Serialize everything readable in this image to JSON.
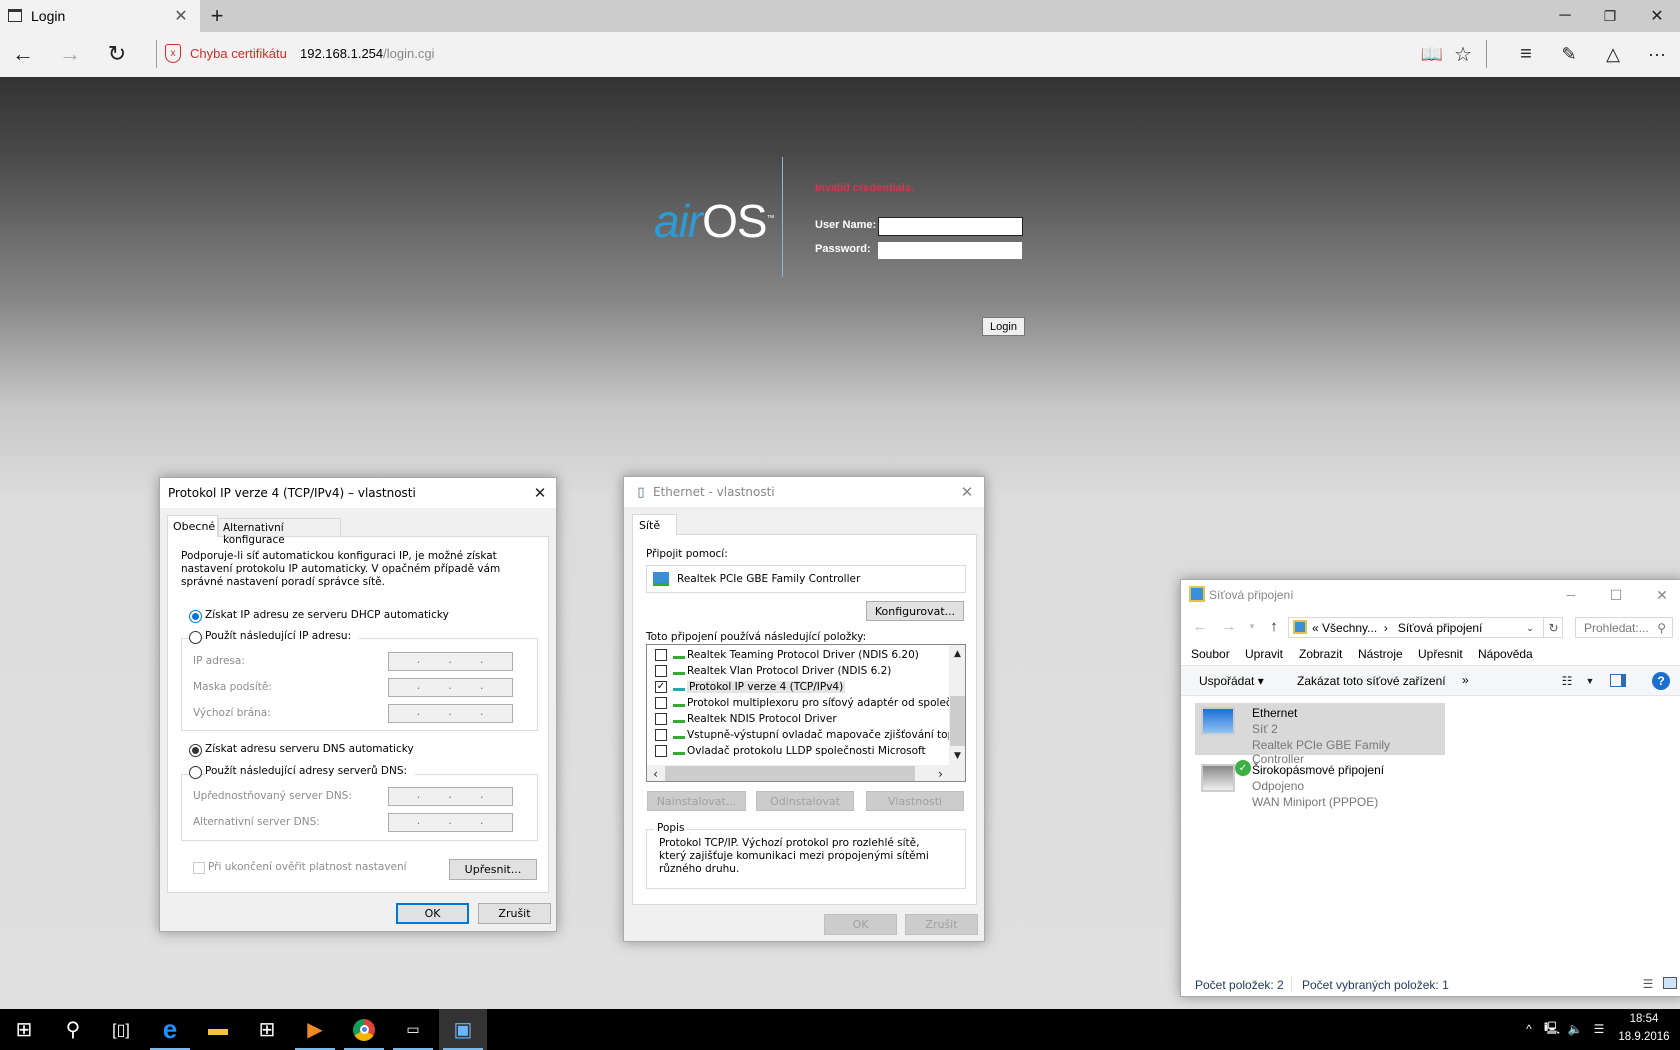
{
  "browser": {
    "tab_title": "Login",
    "cert_error": "Chyba certifikátu",
    "url_host": "192.168.1.254",
    "url_path": "/login.cgi"
  },
  "login": {
    "logo": "airOS",
    "error": "Invalid credentials.",
    "username_label": "User Name:",
    "password_label": "Password:",
    "username": "",
    "password": "",
    "login_button": "Login"
  },
  "ipv4": {
    "title": "Protokol IP verze 4 (TCP/IPv4) – vlastnosti",
    "tabs": [
      "Obecné",
      "Alternativní konfigurace"
    ],
    "intro": "Podporuje-li síť automatickou konfiguraci IP, je možné získat nastavení protokolu IP automaticky. V opačném případě vám správné nastavení poradí správce sítě.",
    "radio_auto_ip": "Získat IP adresu ze serveru DHCP automaticky",
    "radio_manual_ip": "Použít následující IP adresu:",
    "ip_label": "IP adresa:",
    "mask_label": "Maska podsítě:",
    "gateway_label": "Výchozí brána:",
    "radio_auto_dns": "Získat adresu serveru DNS automaticky",
    "radio_manual_dns": "Použít následující adresy serverů DNS:",
    "dns1_label": "Upřednostňovaný server DNS:",
    "dns2_label": "Alternativní server DNS:",
    "validate_label": "Při ukončení ověřit platnost nastavení",
    "advanced": "Upřesnit...",
    "ok": "OK",
    "cancel": "Zrušit"
  },
  "eth": {
    "title": "Ethernet - vlastnosti",
    "tab": "Sítě",
    "connect_using": "Připojit pomocí:",
    "adapter": "Realtek PCIe GBE Family Controller",
    "configure": "Konfigurovat...",
    "items_label": "Toto připojení používá následující položky:",
    "items": [
      {
        "label": "Realtek Teaming Protocol Driver (NDIS 6.20)",
        "checked": false
      },
      {
        "label": "Realtek Vlan Protocol Driver (NDIS 6.2)",
        "checked": false
      },
      {
        "label": "Protokol IP verze 4 (TCP/IPv4)",
        "checked": true
      },
      {
        "label": "Protokol multiplexoru pro síťový adaptér od společnosti",
        "checked": false
      },
      {
        "label": "Realtek NDIS Protocol Driver",
        "checked": false
      },
      {
        "label": "Vstupně-výstupní ovladač mapovače zjišťování topolo",
        "checked": false
      },
      {
        "label": "Ovladač protokolu LLDP společnosti Microsoft",
        "checked": false
      }
    ],
    "install": "Nainstalovat...",
    "uninstall": "Odinstalovat",
    "properties": "Vlastnosti",
    "desc_label": "Popis",
    "desc": "Protokol TCP/IP. Výchozí protokol pro rozlehlé sítě, který zajišťuje komunikaci mezi propojenými sítěmi různého druhu.",
    "ok": "OK",
    "cancel": "Zrušit"
  },
  "net": {
    "title": "Síťová připojení",
    "crumb1": "Všechny...",
    "crumb2": "Síťová připojení",
    "search_placeholder": "Prohledat:...",
    "menu": [
      "Soubor",
      "Upravit",
      "Zobrazit",
      "Nástroje",
      "Upřesnit",
      "Nápověda"
    ],
    "organize": "Uspořádat",
    "disable": "Zakázat toto síťové zařízení",
    "more": "»",
    "items": [
      {
        "name": "Ethernet",
        "status": "Síť 2",
        "device": "Realtek PCIe GBE Family Controller"
      },
      {
        "name": "Širokopásmové připojení",
        "status": "Odpojeno",
        "device": "WAN Miniport (PPPOE)"
      }
    ],
    "count": "Počet položek: 2",
    "selected": "Počet vybraných položek: 1"
  },
  "taskbar": {
    "time": "18:54",
    "date": "18.9.2016"
  }
}
